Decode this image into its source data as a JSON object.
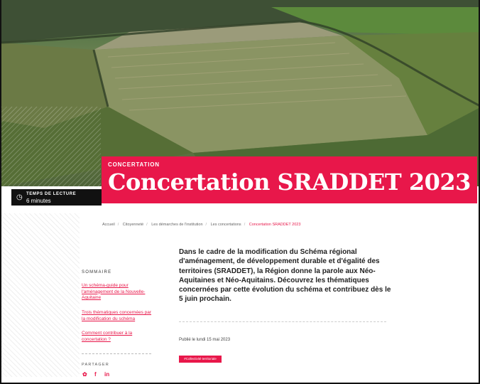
{
  "hero": {
    "kicker": "CONCERTATION",
    "title": "Concertation SRADDET 2023",
    "image_icon": "aerial-fields-image"
  },
  "reading_time": {
    "label": "TEMPS DE LECTURE",
    "value": "6 minutes",
    "icon": "clock-icon"
  },
  "breadcrumb": [
    "Accueil",
    "Citoyenneté",
    "Les démarches de l'institution",
    "Les concertations",
    "Concertation SRADDET 2023"
  ],
  "summary": {
    "title": "SOMMAIRE",
    "items": [
      "Un schéma-guide pour l'aménagement de la Nouvelle-Aquitaine",
      "Trois thématiques concernées par la modification du schéma",
      "Comment contribuer à la concertation ?"
    ]
  },
  "share": {
    "title": "PARTAGER",
    "icons": [
      "twitter-icon",
      "facebook-icon",
      "linkedin-icon"
    ]
  },
  "intro": "Dans le cadre de la modification du Schéma régional d'aménagement, de développement durable et d'égalité des territoires (SRADDET), la Région donne la parole aux Néo-Aquitaines et Néo-Aquitains. Découvrez les thématiques concernées par cette évolution du schéma et contribuez dès le 5 juin prochain.",
  "published": "Publié le lundi 15 mai 2023",
  "tag": "#Collectivité territoriale",
  "colors": {
    "accent": "#e8174a",
    "dark": "#111111"
  }
}
